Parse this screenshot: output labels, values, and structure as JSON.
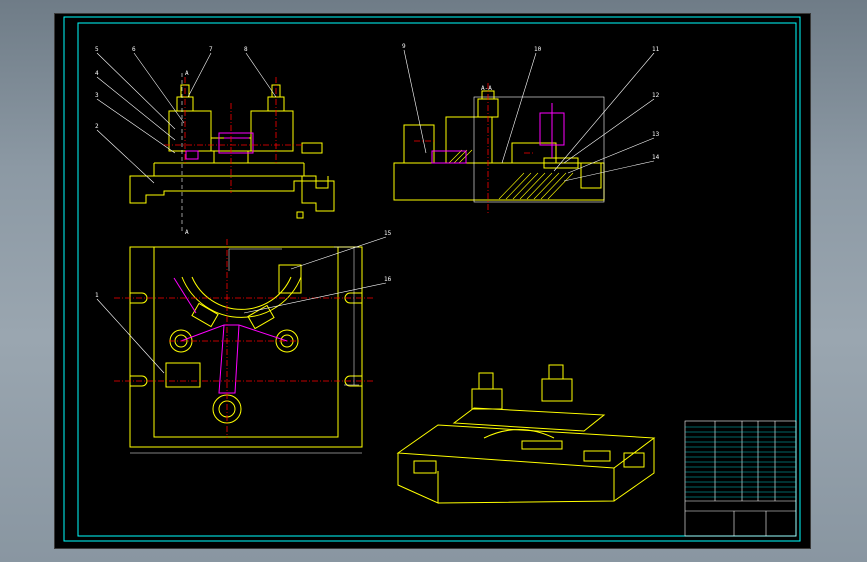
{
  "colors": {
    "background": "#000000",
    "frame": "#00ffff",
    "outline": "#ffff00",
    "center_line": "#ff0000",
    "hidden_part": "#ff00ff",
    "leader": "#ffffff",
    "section_hatch": "#ffff00"
  },
  "section_title": "A-A",
  "part_numbers": [
    "1",
    "2",
    "3",
    "4",
    "5",
    "6",
    "7",
    "8",
    "9",
    "10",
    "11",
    "12",
    "13",
    "14",
    "15",
    "16"
  ],
  "cut_marks": [
    "A",
    "A"
  ],
  "views": {
    "front_view": "front-view",
    "section_view": "section-view",
    "top_view": "top-view",
    "iso_view": "isometric-view"
  },
  "title_block": {
    "present": true
  }
}
